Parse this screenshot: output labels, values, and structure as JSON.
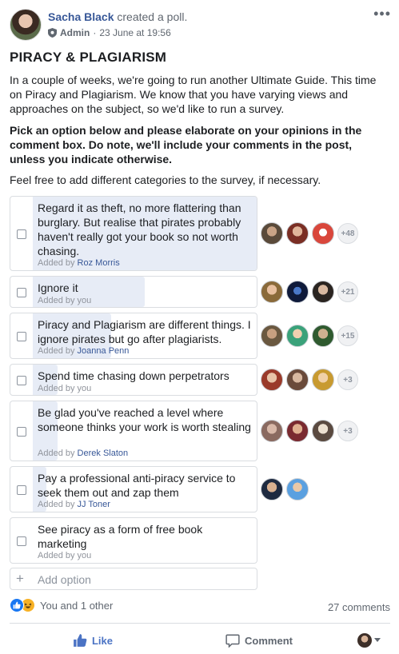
{
  "post": {
    "author": "Sacha Black",
    "action": "created a poll.",
    "role": "Admin",
    "date": "23 June at 19:56",
    "title": "PIRACY & PLAGIARISM",
    "intro": "In a couple of weeks, we're going to run another Ultimate Guide. This time on Piracy and Plagiarism. We know that you have varying views and approaches on the subject, so we'd like to run a survey.",
    "instruction": "Pick an option below and please elaborate on your opinions in the comment box. Do note, we'll include your comments in the post, unless you indicate otherwise.",
    "note": "Feel free to add different categories to the survey, if  necessary."
  },
  "poll": {
    "options": [
      {
        "text": "Regard it as theft, no more flattering than burglary. But realise that pirates probably haven't really got your book so not worth chasing.",
        "added_prefix": "Added by ",
        "added_by": "Roz Morris",
        "more_voters": "+48",
        "vote_share": 1.0
      },
      {
        "text": "Ignore it",
        "added_prefix": "Added by ",
        "added_by": "you",
        "more_voters": "+21",
        "vote_share": 0.5
      },
      {
        "text": "Piracy and Plagiarism are different things. I ignore pirates but go after plagiarists.",
        "added_prefix": "Added by ",
        "added_by": "Joanna Penn",
        "more_voters": "+15",
        "vote_share": 0.35
      },
      {
        "text": "Spend time chasing down perpetrators",
        "added_prefix": "Added by ",
        "added_by": "you",
        "more_voters": "+3",
        "vote_share": 0.11
      },
      {
        "text": "Be glad you've reached a level where someone thinks your work is worth stealing",
        "added_prefix": "Added by ",
        "added_by": "Derek Slaton",
        "more_voters": "+3",
        "vote_share": 0.11
      },
      {
        "text": "Pay a professional anti-piracy service to seek them out and zap them",
        "added_prefix": "Added by ",
        "added_by": "JJ Toner",
        "more_voters": "",
        "vote_share": 0.06
      },
      {
        "text": "See piracy as a form of free book marketing",
        "added_prefix": "Added by ",
        "added_by": "you",
        "more_voters": "",
        "vote_share": 0.0
      }
    ],
    "add_option_placeholder": "Add option"
  },
  "footer": {
    "reactions_text": "You and 1 other",
    "comments_text": "27 comments",
    "like_label": "Like",
    "comment_label": "Comment"
  },
  "colors": {
    "link": "#385898",
    "like_blue": "#4b73c4",
    "vote_fill": "#e7ecf6",
    "border": "#dadde1"
  }
}
